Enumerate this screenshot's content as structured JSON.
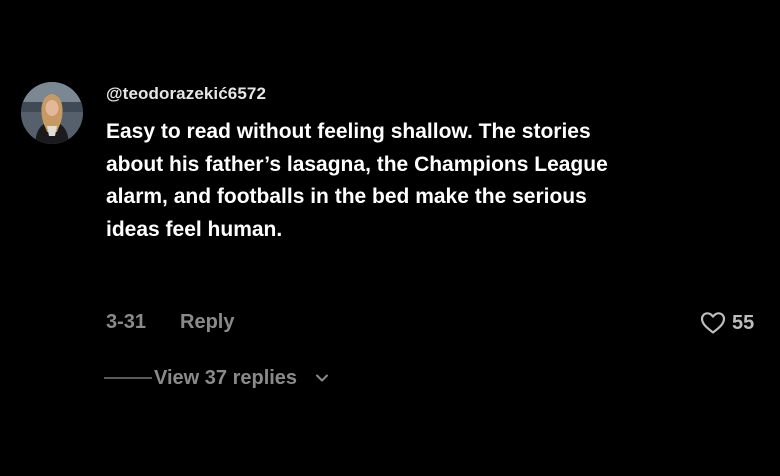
{
  "comment": {
    "author": "@teodorazekić6572",
    "text": "Easy to read without feeling shallow. The stories about his father’s lasagna, the Champions League alarm, and footballs in the bed make the serious ideas feel human.",
    "date": "3-31",
    "reply_label": "Reply",
    "like_count": "55",
    "view_replies_label": "View 37 replies"
  },
  "icons": {
    "like": "heart-outline-icon",
    "expand": "chevron-down-icon"
  },
  "colors": {
    "background": "#000000",
    "text_primary": "#ffffff",
    "text_secondary": "#8a8a8a"
  }
}
